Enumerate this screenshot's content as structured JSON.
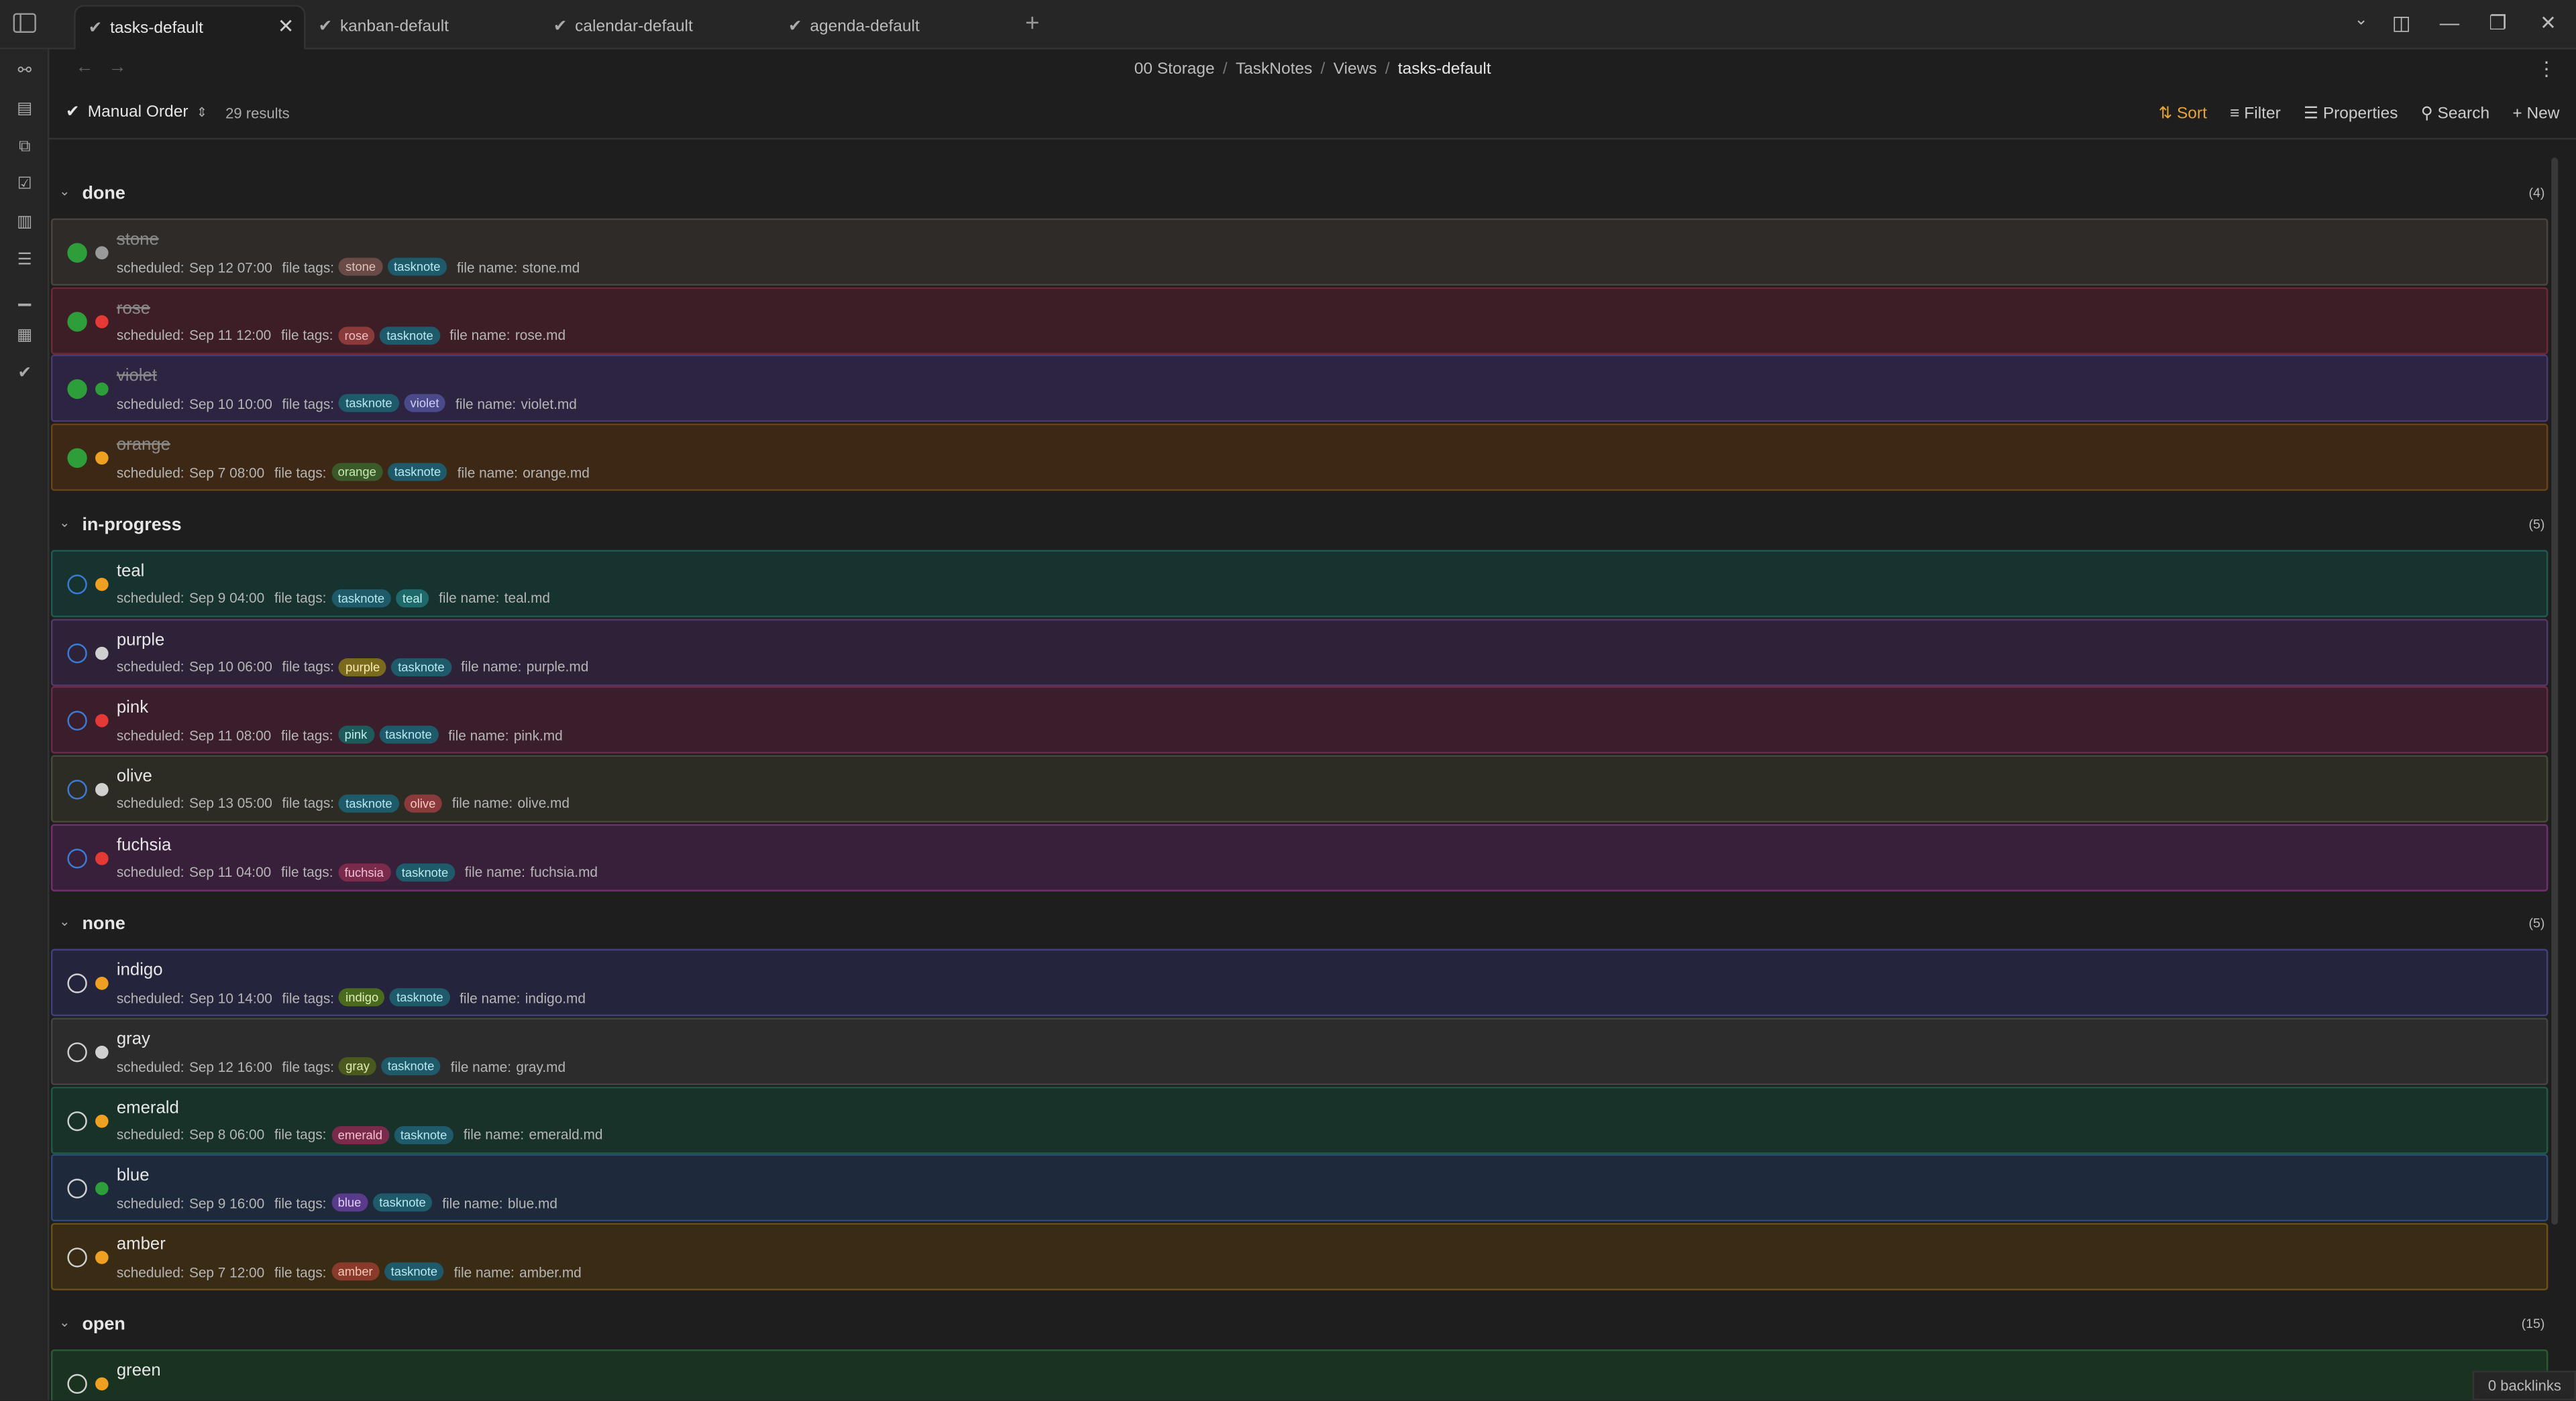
{
  "tabs": [
    {
      "label": "tasks-default",
      "active": true
    },
    {
      "label": "kanban-default",
      "active": false
    },
    {
      "label": "calendar-default",
      "active": false
    },
    {
      "label": "agenda-default",
      "active": false
    }
  ],
  "breadcrumb": [
    "00 Storage",
    "TaskNotes",
    "Views",
    "tasks-default"
  ],
  "toolbar": {
    "order_label": "Manual Order",
    "results": "29 results",
    "sort": "Sort",
    "filter": "Filter",
    "properties": "Properties",
    "search": "Search",
    "new": "New"
  },
  "groups": [
    {
      "name": "done",
      "count": "(4)",
      "tasks": [
        {
          "title": "stone",
          "scheduled": "Sep 12 07:00",
          "tags": [
            "stone",
            "tasknote"
          ],
          "file": "stone.md",
          "prio_color": "#9a9a9a",
          "status": "done"
        },
        {
          "title": "rose",
          "scheduled": "Sep 11 12:00",
          "tags": [
            "rose",
            "tasknote"
          ],
          "file": "rose.md",
          "prio_color": "#e53935",
          "status": "done"
        },
        {
          "title": "violet",
          "scheduled": "Sep 10 10:00",
          "tags": [
            "tasknote",
            "violet"
          ],
          "file": "violet.md",
          "prio_color": "#2e9e3a",
          "status": "done"
        },
        {
          "title": "orange",
          "scheduled": "Sep 7 08:00",
          "tags": [
            "orange",
            "tasknote"
          ],
          "file": "orange.md",
          "prio_color": "#f0a020",
          "status": "done"
        }
      ]
    },
    {
      "name": "in-progress",
      "count": "(5)",
      "tasks": [
        {
          "title": "teal",
          "scheduled": "Sep 9 04:00",
          "tags": [
            "tasknote",
            "teal"
          ],
          "file": "teal.md",
          "prio_color": "#f0a020",
          "status": "in-progress"
        },
        {
          "title": "purple",
          "scheduled": "Sep 10 06:00",
          "tags": [
            "purple",
            "tasknote"
          ],
          "file": "purple.md",
          "prio_color": "#d0d0d0",
          "status": "in-progress"
        },
        {
          "title": "pink",
          "scheduled": "Sep 11 08:00",
          "tags": [
            "pink",
            "tasknote"
          ],
          "file": "pink.md",
          "prio_color": "#e53935",
          "status": "in-progress"
        },
        {
          "title": "olive",
          "scheduled": "Sep 13 05:00",
          "tags": [
            "tasknote",
            "olive"
          ],
          "file": "olive.md",
          "prio_color": "#d0d0d0",
          "status": "in-progress"
        },
        {
          "title": "fuchsia",
          "scheduled": "Sep 11 04:00",
          "tags": [
            "fuchsia",
            "tasknote"
          ],
          "file": "fuchsia.md",
          "prio_color": "#e53935",
          "status": "in-progress"
        }
      ]
    },
    {
      "name": "none",
      "count": "(5)",
      "tasks": [
        {
          "title": "indigo",
          "scheduled": "Sep 10 14:00",
          "tags": [
            "indigo",
            "tasknote"
          ],
          "file": "indigo.md",
          "prio_color": "#f0a020",
          "status": "none"
        },
        {
          "title": "gray",
          "scheduled": "Sep 12 16:00",
          "tags": [
            "gray",
            "tasknote"
          ],
          "file": "gray.md",
          "prio_color": "#d0d0d0",
          "status": "none"
        },
        {
          "title": "emerald",
          "scheduled": "Sep 8 06:00",
          "tags": [
            "emerald",
            "tasknote"
          ],
          "file": "emerald.md",
          "prio_color": "#f0a020",
          "status": "none"
        },
        {
          "title": "blue",
          "scheduled": "Sep 9 16:00",
          "tags": [
            "blue",
            "tasknote"
          ],
          "file": "blue.md",
          "prio_color": "#2e9e3a",
          "status": "none"
        },
        {
          "title": "amber",
          "scheduled": "Sep 7 12:00",
          "tags": [
            "amber",
            "tasknote"
          ],
          "file": "amber.md",
          "prio_color": "#f0a020",
          "status": "none"
        }
      ]
    },
    {
      "name": "open",
      "count": "(15)",
      "tasks": [
        {
          "title": "green",
          "scheduled": "",
          "tags": [],
          "file": "",
          "prio_color": "#f0a020",
          "status": "none"
        }
      ]
    }
  ],
  "labels": {
    "scheduled": "scheduled:",
    "file_tags": "file tags:",
    "file_name": "file name:"
  },
  "card_colors": {
    "stone": [
      "#2e2b29",
      "#4a4440"
    ],
    "rose": [
      "#3e1e26",
      "#6a2a38"
    ],
    "violet": [
      "#2c2440",
      "#4a3a70"
    ],
    "orange": [
      "#3c2814",
      "#6a4218"
    ],
    "teal": [
      "#163330",
      "#1f5a52"
    ],
    "purple": [
      "#2e2238",
      "#54386a"
    ],
    "pink": [
      "#3a1e2c",
      "#6a2a4a"
    ],
    "olive": [
      "#2c2c24",
      "#48483a"
    ],
    "fuchsia": [
      "#38203a",
      "#70306e"
    ],
    "indigo": [
      "#24243c",
      "#40407a"
    ],
    "gray": [
      "#2c2c2c",
      "#444444"
    ],
    "emerald": [
      "#18322a",
      "#1e5a44"
    ],
    "blue": [
      "#1e2a3c",
      "#2a4a78"
    ],
    "amber": [
      "#3a2c14",
      "#6a5018"
    ],
    "green": [
      "#1a3220",
      "#2a5a34"
    ]
  },
  "tag_colors": {
    "stone": [
      "#6a4a46",
      "#e0c0b8"
    ],
    "rose": [
      "#8a3a3a",
      "#f0c0c0"
    ],
    "violet": [
      "#4a4a8a",
      "#d0d0f8"
    ],
    "orange": [
      "#3a5a2a",
      "#c8e8b0"
    ],
    "teal": [
      "#1e6a6a",
      "#c0f0f0"
    ],
    "purple": [
      "#7a6a1e",
      "#f8ecb0"
    ],
    "pink": [
      "#1e5a5a",
      "#c0ecec"
    ],
    "olive": [
      "#8a3a3a",
      "#f8c8c0"
    ],
    "fuchsia": [
      "#7a2a4a",
      "#f8c0d8"
    ],
    "indigo": [
      "#4a6a1e",
      "#e0f0b8"
    ],
    "gray": [
      "#4a5a1e",
      "#e0ecb0"
    ],
    "emerald": [
      "#7a2a4a",
      "#f8c0d0"
    ],
    "blue": [
      "#5a3a8a",
      "#e0d0f8"
    ],
    "amber": [
      "#8a3a2a",
      "#f8c8b8"
    ],
    "tasknote": [
      "#1e5a6a",
      "#b8e8f0"
    ]
  },
  "backlinks": "0 backlinks"
}
